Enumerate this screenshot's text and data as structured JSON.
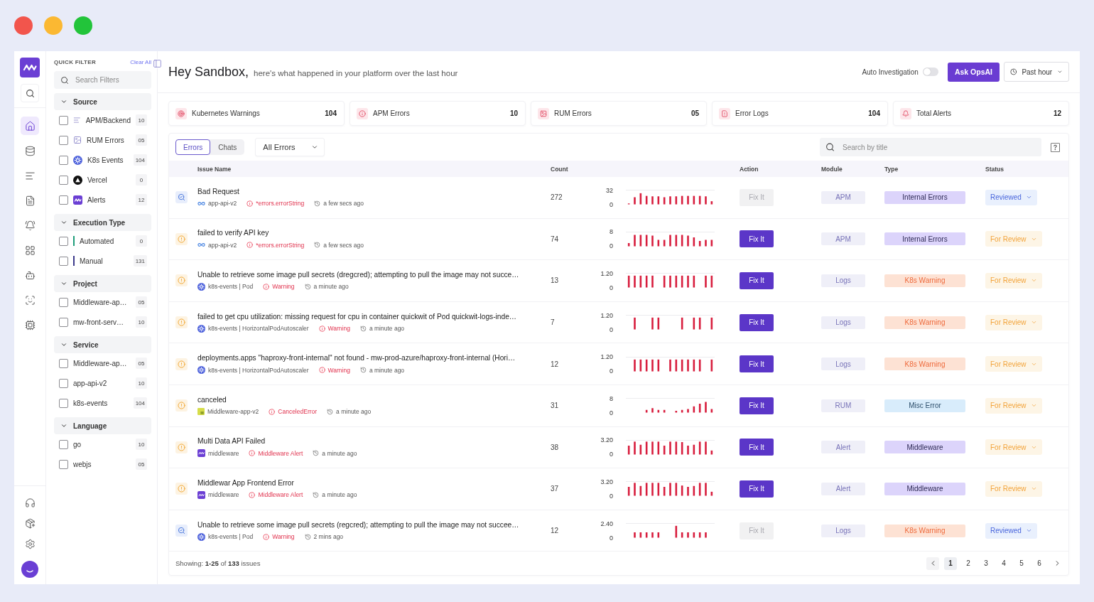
{
  "rail": {
    "items": [
      {
        "kind": "home",
        "selected": true
      },
      {
        "kind": "database",
        "selected": false
      },
      {
        "kind": "logs",
        "selected": false
      },
      {
        "kind": "file",
        "selected": false
      },
      {
        "kind": "bell",
        "selected": false
      },
      {
        "kind": "grid",
        "selected": false
      },
      {
        "kind": "robot",
        "selected": false
      },
      {
        "kind": "scan",
        "selected": false
      },
      {
        "kind": "chip",
        "selected": false
      }
    ],
    "bottom_items": [
      {
        "kind": "headphones"
      },
      {
        "kind": "package"
      },
      {
        "kind": "settings"
      }
    ]
  },
  "quick_filter": {
    "title": "QUICK FILTER",
    "clear_label": "Clear All",
    "search": {
      "placeholder": "Search Filters"
    },
    "sections": [
      {
        "title": "Source",
        "expanded": true,
        "items": [
          {
            "label": "APM/Backend",
            "count": "10",
            "checked": false,
            "kind": "apm"
          },
          {
            "label": "RUM Errors",
            "count": "05",
            "checked": false,
            "kind": "rum"
          },
          {
            "label": "K8s Events",
            "count": "104",
            "checked": false,
            "kind": "k8s"
          },
          {
            "label": "Vercel",
            "count": "0",
            "checked": false,
            "kind": "vercel"
          },
          {
            "label": "Alerts",
            "count": "12",
            "checked": false,
            "kind": "alerts"
          }
        ]
      },
      {
        "title": "Execution Type",
        "expanded": true,
        "items": [
          {
            "label": "Automated",
            "count": "0",
            "checked": false,
            "kind": "marker",
            "color": "#1f9d7a"
          },
          {
            "label": "Manual",
            "count": "131",
            "checked": false,
            "kind": "marker",
            "color": "#3d3a8c"
          }
        ]
      },
      {
        "title": "Project",
        "expanded": true,
        "items": [
          {
            "label": "Middleware-ap…",
            "count": "05",
            "checked": false
          },
          {
            "label": "mw-front-serv…",
            "count": "10",
            "checked": false
          }
        ]
      },
      {
        "title": "Service",
        "expanded": true,
        "items": [
          {
            "label": "Middleware-ap…",
            "count": "05",
            "checked": false
          },
          {
            "label": "app-api-v2",
            "count": "10",
            "checked": false
          },
          {
            "label": "k8s-events",
            "count": "104",
            "checked": false
          }
        ]
      },
      {
        "title": "Language",
        "expanded": true,
        "items": [
          {
            "label": "go",
            "count": "10",
            "checked": false
          },
          {
            "label": "webjs",
            "count": "05",
            "checked": false
          }
        ]
      }
    ]
  },
  "header": {
    "greeting": "Hey Sandbox,",
    "subtitle": "here's what happened in your platform over the last hour",
    "auto_investigation": {
      "label": "Auto Investigation",
      "on": false
    },
    "ask_button": "Ask OpsAI",
    "time_range": "Past hour"
  },
  "stats": [
    {
      "label": "Kubernetes Warnings",
      "value": "104",
      "kind": "k8s"
    },
    {
      "label": "APM Errors",
      "value": "10",
      "kind": "apm"
    },
    {
      "label": "RUM Errors",
      "value": "05",
      "kind": "rum"
    },
    {
      "label": "Error Logs",
      "value": "104",
      "kind": "logs"
    },
    {
      "label": "Total Alerts",
      "value": "12",
      "kind": "alerts"
    }
  ],
  "issues": {
    "tabs": [
      {
        "label": "Errors",
        "selected": true
      },
      {
        "label": "Chats",
        "selected": false
      }
    ],
    "filter": "All Errors",
    "search": {
      "placeholder": "Search by title"
    },
    "columns": [
      "Issue Name",
      "Count",
      "Action",
      "Module",
      "Type",
      "Status"
    ],
    "rows": [
      {
        "title": "Bad Request",
        "source": {
          "label": "app-api-v2",
          "kind": "apm"
        },
        "error": "*errors.errorString",
        "time": "a few secs ago",
        "count": "272",
        "chart_data": {
          "type": "bar",
          "ylim": [
            0,
            32
          ],
          "yticks": [
            0,
            32
          ],
          "values": [
            2,
            16,
            25,
            19,
            18,
            18,
            16,
            18,
            18,
            19,
            19,
            19,
            19,
            18,
            7
          ]
        },
        "action": {
          "label": "Fix It",
          "disabled": true
        },
        "module": "APM",
        "type": {
          "label": "Internal Errors",
          "kind": "internal"
        },
        "status": {
          "label": "Reviewed",
          "kind": "reviewed"
        }
      },
      {
        "title": "failed to verify API key",
        "source": {
          "label": "app-api-v2",
          "kind": "apm"
        },
        "error": "*errors.errorString",
        "time": "a few secs ago",
        "count": "74",
        "chart_data": {
          "type": "bar",
          "ylim": [
            0,
            8
          ],
          "yticks": [
            0,
            8
          ],
          "values": [
            1.8,
            6.4,
            6.4,
            6.4,
            6,
            3.6,
            3.6,
            6.4,
            6.4,
            6.4,
            6,
            5,
            3,
            3.6,
            3.6
          ]
        },
        "action": {
          "label": "Fix It",
          "disabled": false
        },
        "module": "APM",
        "type": {
          "label": "Internal Errors",
          "kind": "internal"
        },
        "status": {
          "label": "For Review",
          "kind": "for_review"
        }
      },
      {
        "title": "Unable to retrieve some image pull secrets (dregcred); attempting to pull the image may not succe…",
        "source": {
          "label": "k8s-events | Pod",
          "kind": "k8s"
        },
        "error": "Warning",
        "time": "a minute ago",
        "count": "13",
        "chart_data": {
          "type": "bar",
          "ylim": [
            0,
            1.2
          ],
          "yticks": [
            0,
            {
              "value": 1.2,
              "label": "1.20"
            }
          ],
          "values": [
            1,
            1,
            1,
            1,
            1,
            0,
            1,
            1,
            1,
            1,
            1,
            1,
            0,
            1,
            1
          ]
        },
        "action": {
          "label": "Fix It",
          "disabled": false
        },
        "module": "Logs",
        "type": {
          "label": "K8s Warning",
          "kind": "k8s"
        },
        "status": {
          "label": "For Review",
          "kind": "for_review"
        }
      },
      {
        "title": "failed to get cpu utilization: missing request for cpu in container quickwit of Pod quickwit-logs-inde…",
        "source": {
          "label": "k8s-events | HorizontalPodAutoscaler",
          "kind": "k8s"
        },
        "error": "Warning",
        "time": "a minute ago",
        "count": "7",
        "chart_data": {
          "type": "bar",
          "ylim": [
            0,
            1.2
          ],
          "yticks": [
            0,
            {
              "value": 1.2,
              "label": "1.20"
            }
          ],
          "values": [
            0,
            1,
            0,
            0,
            1,
            1,
            0,
            0,
            0,
            1,
            0,
            1,
            1,
            0,
            1
          ]
        },
        "action": {
          "label": "Fix It",
          "disabled": false
        },
        "module": "Logs",
        "type": {
          "label": "K8s Warning",
          "kind": "k8s"
        },
        "status": {
          "label": "For Review",
          "kind": "for_review"
        }
      },
      {
        "title": "deployments.apps \"haproxy-front-internal\" not found - mw-prod-azure/haproxy-front-internal (Hori…",
        "source": {
          "label": "k8s-events | HorizontalPodAutoscaler",
          "kind": "k8s"
        },
        "error": "Warning",
        "time": "a minute ago",
        "count": "12",
        "chart_data": {
          "type": "bar",
          "ylim": [
            0,
            1.2
          ],
          "yticks": [
            0,
            {
              "value": 1.2,
              "label": "1.20"
            }
          ],
          "values": [
            0,
            1,
            1,
            1,
            1,
            1,
            0,
            1,
            1,
            1,
            1,
            1,
            1,
            0,
            1
          ]
        },
        "action": {
          "label": "Fix It",
          "disabled": false
        },
        "module": "Logs",
        "type": {
          "label": "K8s Warning",
          "kind": "k8s"
        },
        "status": {
          "label": "For Review",
          "kind": "for_review"
        }
      },
      {
        "title": "canceled",
        "source": {
          "label": "Middleware-app-v2",
          "kind": "js"
        },
        "error": "CanceledError",
        "time": "a minute ago",
        "count": "31",
        "chart_data": {
          "type": "bar",
          "ylim": [
            0,
            8
          ],
          "yticks": [
            0,
            8
          ],
          "values": [
            0,
            0,
            0,
            1.5,
            2.5,
            1.5,
            1.5,
            0,
            1,
            1.5,
            2,
            3.5,
            5,
            6,
            2
          ]
        },
        "action": {
          "label": "Fix It",
          "disabled": false
        },
        "module": "RUM",
        "type": {
          "label": "Misc Error",
          "kind": "misc"
        },
        "status": {
          "label": "For Review",
          "kind": "for_review"
        }
      },
      {
        "title": "Multi Data API Failed",
        "source": {
          "label": "middleware",
          "kind": "middleware"
        },
        "error": "Middleware Alert",
        "time": "a minute ago",
        "count": "38",
        "chart_data": {
          "type": "bar",
          "ylim": [
            0,
            3.2
          ],
          "yticks": [
            0,
            {
              "value": 3.2,
              "label": "3.20"
            }
          ],
          "values": [
            2,
            2.9,
            2.2,
            2.9,
            2.9,
            2.9,
            2,
            2.9,
            2.9,
            2.8,
            2,
            2.2,
            2.9,
            2.9,
            0.9
          ]
        },
        "action": {
          "label": "Fix It",
          "disabled": false
        },
        "module": "Alert",
        "type": {
          "label": "Middleware",
          "kind": "middleware"
        },
        "status": {
          "label": "For Review",
          "kind": "for_review"
        }
      },
      {
        "title": "Middlewar App Frontend Error",
        "source": {
          "label": "middleware",
          "kind": "middleware"
        },
        "error": "Middleware Alert",
        "time": "a minute ago",
        "count": "37",
        "chart_data": {
          "type": "bar",
          "ylim": [
            0,
            3.2
          ],
          "yticks": [
            0,
            {
              "value": 3.2,
              "label": "3.20"
            }
          ],
          "values": [
            2,
            2.9,
            2.2,
            2.9,
            2.9,
            2.9,
            2,
            2.9,
            2.9,
            2.3,
            2,
            2.2,
            2.9,
            2.9,
            0.9
          ]
        },
        "action": {
          "label": "Fix It",
          "disabled": false
        },
        "module": "Alert",
        "type": {
          "label": "Middleware",
          "kind": "middleware"
        },
        "status": {
          "label": "For Review",
          "kind": "for_review"
        }
      },
      {
        "title": "Unable to retrieve some image pull secrets (regcred); attempting to pull the image may not succee…",
        "source": {
          "label": "k8s-events | Pod",
          "kind": "k8s"
        },
        "error": "Warning",
        "time": "2 mins ago",
        "count": "12",
        "chart_data": {
          "type": "bar",
          "ylim": [
            0,
            2.4
          ],
          "yticks": [
            0,
            {
              "value": 2.4,
              "label": "2.40"
            }
          ],
          "values": [
            0,
            0.9,
            0.9,
            0.9,
            0.9,
            0.9,
            0,
            0,
            2,
            0.9,
            0.9,
            0.9,
            0.9,
            0.9,
            0
          ]
        },
        "action": {
          "label": "Fix It",
          "disabled": true
        },
        "module": "Logs",
        "type": {
          "label": "K8s Warning",
          "kind": "k8s"
        },
        "status": {
          "label": "Reviewed",
          "kind": "reviewed"
        }
      }
    ],
    "footer": "Showing: **1-25** of **133** issues",
    "pagination": {
      "pages": [
        {
          "label": "1",
          "selected": true
        },
        {
          "label": "2",
          "selected": false
        },
        {
          "label": "3",
          "selected": false
        },
        {
          "label": "4",
          "selected": false
        },
        {
          "label": "5",
          "selected": false
        },
        {
          "label": "6",
          "selected": false
        }
      ]
    }
  }
}
